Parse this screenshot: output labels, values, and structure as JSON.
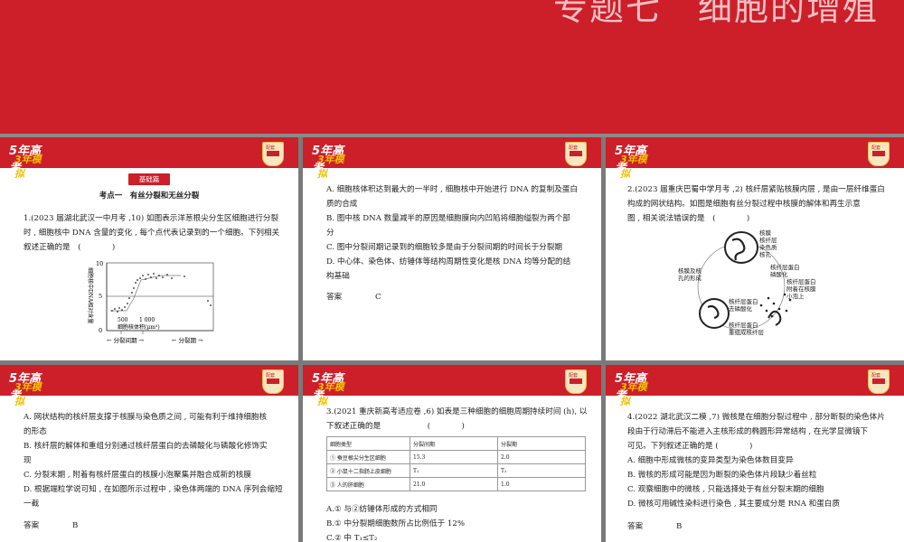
{
  "banner": {
    "title": "专题七　细胞的增殖"
  },
  "logo": {
    "line1": "5年高考",
    "line2": "3年模拟"
  },
  "badge": {
    "text": "配套"
  },
  "slide1": {
    "pill": "基础篇",
    "section_title": "考点一　有丝分裂和无丝分裂",
    "q_lines": [
      "1.(2023 届湖北武汉一中月考 ,10) 如图表示洋葱根尖分生区细胞进行分裂",
      "时 , 细胞核中 DNA 含量的变化 , 每个点代表记录到的一个细胞。下列相关",
      "叙述正确的是　(　　　　)"
    ],
    "graph": {
      "ylabel": "细胞核中DNA相对含量",
      "xlabel": "细胞核体积(μm³)",
      "yticks": [
        "10",
        "5",
        "0"
      ],
      "xticks": [
        "500",
        "1 000"
      ],
      "phase_interphase": "分裂间期",
      "phase_mitosis": "分裂期"
    }
  },
  "slide2": {
    "lines": [
      "A. 细胞核体积达到最大的一半时 , 细胞核中开始进行 DNA 的复制及蛋白",
      "质的合成",
      "B. 图中核 DNA 数量减半的原因是细胞膜向内凹陷将细胞缢裂为两个部",
      "分",
      "C. 图中分裂间期记录到的细胞较多是由于分裂间期的时间长于分裂期",
      "D. 中心体、染色体、纺锤体等结构周期性变化是核 DNA 均等分配的结",
      "构基础"
    ],
    "answer_label": "答案",
    "answer": "C"
  },
  "slide3": {
    "lines": [
      "2.(2023 届重庆巴蜀中学月考 ,2) 核纤层紧贴核膜内层 , 是由一层纤维蛋白",
      "构成的网状结构。如图是细胞有丝分裂过程中核膜的解体和再生示意",
      "图 , 相关说法错误的是　(　　　　)"
    ],
    "diagram": {
      "labels": [
        "核膜",
        "核纤层",
        "染色质",
        "核孔",
        "核纤层蛋白",
        "磷酸化",
        "核纤层蛋白",
        "附着在核膜",
        "小泡上",
        "核纤层蛋白",
        "去磷酸化",
        "核纤层蛋白",
        "重组成核纤层",
        "核膜及核",
        "孔的形成"
      ]
    }
  },
  "slide4": {
    "lines": [
      "A. 网状结构的核纤层支撑于核膜与染色质之间 , 可能有利于维持细胞核",
      "的形态",
      "B. 核纤层的解体和重组分别通过核纤层蛋白的去磷酸化与磷酸化修饰实",
      "现",
      "C. 分裂末期 , 附着有核纤层蛋白的核膜小泡聚集并融合成新的核膜",
      "D. 根据端粒学说可知 , 在如图所示过程中 , 染色体两端的 DNA 序列会缩短",
      "一截"
    ],
    "answer_label": "答案",
    "answer": "B"
  },
  "slide5": {
    "lines": [
      "3.(2021 重庆新高考适应卷 ,6) 如表是三种细胞的细胞周期持续时间 (h), 以",
      "下叙述正确的是　　　　　　(　　　　)"
    ],
    "table": {
      "headers": [
        "细胞类型",
        "分裂间期",
        "分裂期"
      ],
      "rows": [
        [
          "① 蚕豆根尖分生区细胞",
          "15.3",
          "2.0"
        ],
        [
          "② 小鼠十二指肠上皮细胞",
          "T₁",
          "T₂"
        ],
        [
          "③ 人的肝细胞",
          "21.0",
          "1.0"
        ]
      ]
    },
    "options": [
      "A.① 与②纺锤体形成的方式相同",
      "B.① 中分裂期细胞数所占比例低于 12%",
      "C.② 中 T₁≤T₂"
    ]
  },
  "slide6": {
    "lines": [
      "4.(2022 湖北武汉二模 ,7) 微核是在细胞分裂过程中 , 部分断裂的染色体片",
      "段由于行动滞后不能进入主核形成的椭圆形异常结构 , 在光学显微镜下",
      "可见。下列叙述正确的是 (　　　　)",
      "A. 细胞中形成微核的变异类型为染色体数目变异",
      "B. 微核的形成可能是因为断裂的染色体片段缺少着丝粒",
      "C. 观察细胞中的微核 , 只能选择处于有丝分裂末期的细胞",
      "D. 微核可用碱性染料进行染色 , 其主要成分是 RNA 和蛋白质"
    ],
    "answer_label": "答案",
    "answer": "B"
  }
}
